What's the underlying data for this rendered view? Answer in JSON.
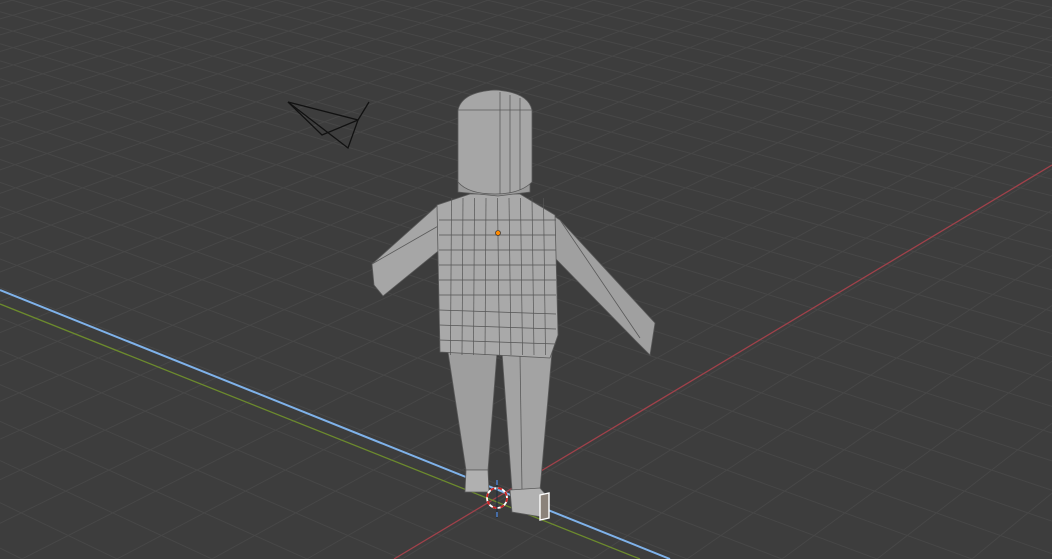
{
  "viewport": {
    "background": "#3d3d3d",
    "grid_color": "#474747",
    "axis_x_color": "#a0414a",
    "axis_y_color": "#6c8a2d",
    "axis_z_color": "#7fb2ea",
    "mesh_color": "#a8a8a8",
    "selection_color": "#ffffff",
    "origin_color": "#ff8a00"
  },
  "objects": [
    "camera",
    "character-mesh",
    "3d-cursor"
  ]
}
